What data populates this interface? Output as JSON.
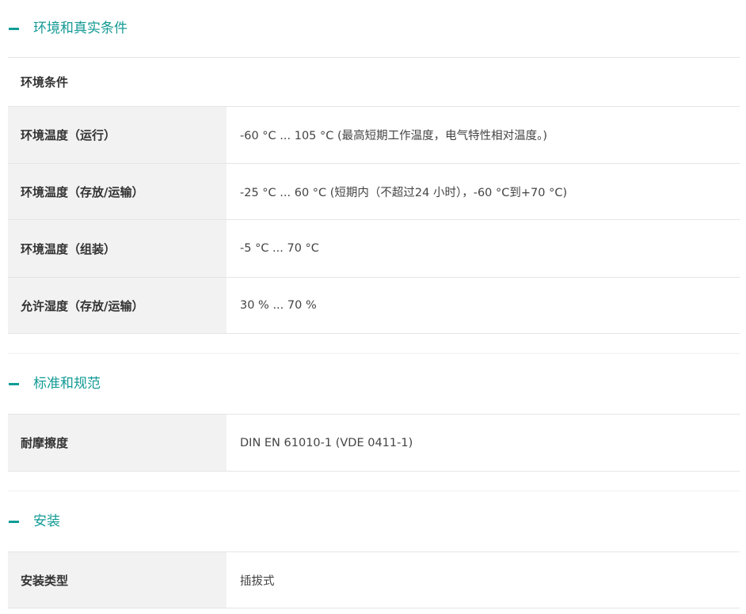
{
  "sections": [
    {
      "title": "环境和真实条件",
      "subhead": "环境条件",
      "rows": [
        {
          "key": "环境温度（运行）",
          "value": "-60 °C ... 105 °C (最高短期工作温度，电气特性相对温度。)"
        },
        {
          "key": "环境温度（存放/运输）",
          "value": "-25 °C ... 60 °C (短期内（不超过24  小时），-60 °C到+70 °C)"
        },
        {
          "key": "环境温度（组装）",
          "value": "-5 °C ... 70 °C"
        },
        {
          "key": "允许湿度（存放/运输）",
          "value": "30 % ... 70 %"
        }
      ]
    },
    {
      "title": "标准和规范",
      "rows": [
        {
          "key": "耐摩擦度",
          "value": "DIN EN 61010-1 (VDE 0411-1)"
        }
      ]
    },
    {
      "title": "安装",
      "rows": [
        {
          "key": "安装类型",
          "value": "插拔式"
        }
      ]
    }
  ],
  "colors": {
    "accent": "#139a95",
    "key_bg": "#f2f2f2",
    "divider": "#e5e5e5"
  },
  "icons": {
    "section_toggle": "minus-icon"
  }
}
